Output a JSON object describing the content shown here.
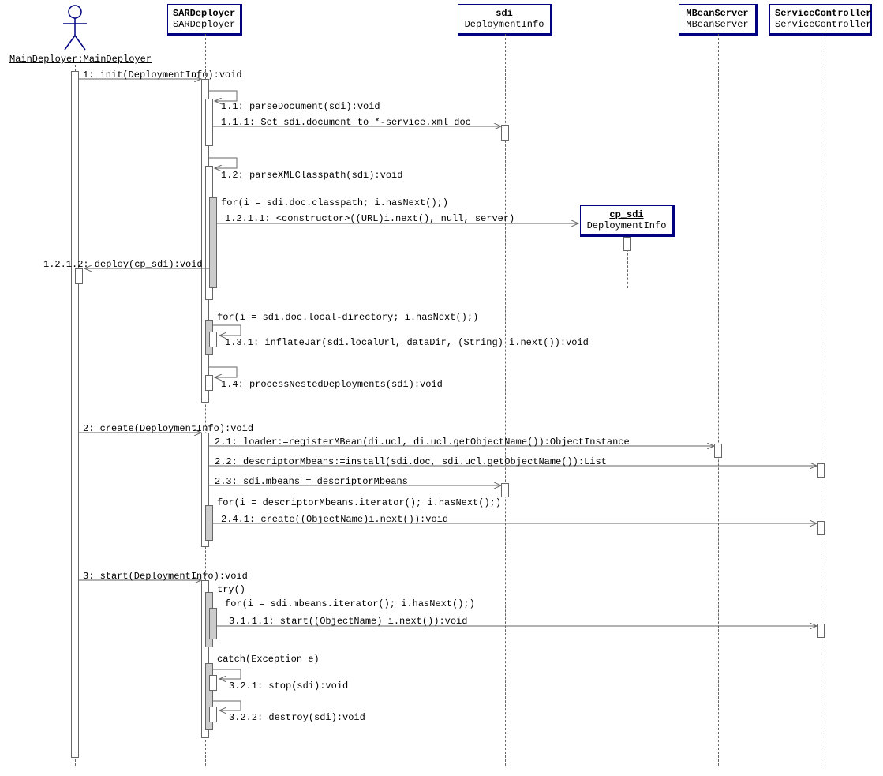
{
  "actors": {
    "mainDeployer": {
      "label": "MainDeployer:MainDeployer"
    }
  },
  "participants": {
    "sarDeployer": {
      "name": "SARDeployer",
      "type": "SARDeployer"
    },
    "sdi": {
      "name": "sdi",
      "type": "DeploymentInfo"
    },
    "mbeanServer": {
      "name": "MBeanServer",
      "type": "MBeanServer"
    },
    "serviceController": {
      "name": "ServiceController",
      "type": "ServiceController"
    },
    "cpSdi": {
      "name": "cp_sdi",
      "type": "DeploymentInfo"
    }
  },
  "messages": {
    "m1": "1: init(DeploymentInfo):void",
    "m1_1": "1.1: parseDocument(sdi):void",
    "m1_1_1": "1.1.1: Set sdi.document to *-service.xml doc",
    "m1_2": "1.2: parseXMLClasspath(sdi):void",
    "m1_2_loop": "for(i = sdi.doc.classpath; i.hasNext();)",
    "m1_2_1_1": "1.2.1.1: <constructor>((URL)i.next(), null, server)",
    "m1_2_1_2": "1.2.1.2: deploy(cp_sdi):void",
    "m1_3_loop": "for(i = sdi.doc.local-directory; i.hasNext();)",
    "m1_3_1": "1.3.1: inflateJar(sdi.localUrl, dataDir, (String) i.next()):void",
    "m1_4": "1.4: processNestedDeployments(sdi):void",
    "m2": "2: create(DeploymentInfo):void",
    "m2_1": "2.1: loader:=registerMBean(di.ucl, di.ucl.getObjectName()):ObjectInstance",
    "m2_2": "2.2: descriptorMbeans:=install(sdi.doc, sdi.ucl.getObjectName()):List",
    "m2_3": "2.3: sdi.mbeans = descriptorMbeans",
    "m2_4_loop": "for(i = descriptorMbeans.iterator(); i.hasNext();)",
    "m2_4_1": "2.4.1: create((ObjectName)i.next()):void",
    "m3": "3: start(DeploymentInfo):void",
    "m3_try": "try()",
    "m3_1_loop": "for(i = sdi.mbeans.iterator(); i.hasNext();)",
    "m3_1_1_1": "3.1.1.1: start((ObjectName) i.next()):void",
    "m3_catch": "catch(Exception e)",
    "m3_2_1": "3.2.1: stop(sdi):void",
    "m3_2_2": "3.2.2: destroy(sdi):void"
  }
}
